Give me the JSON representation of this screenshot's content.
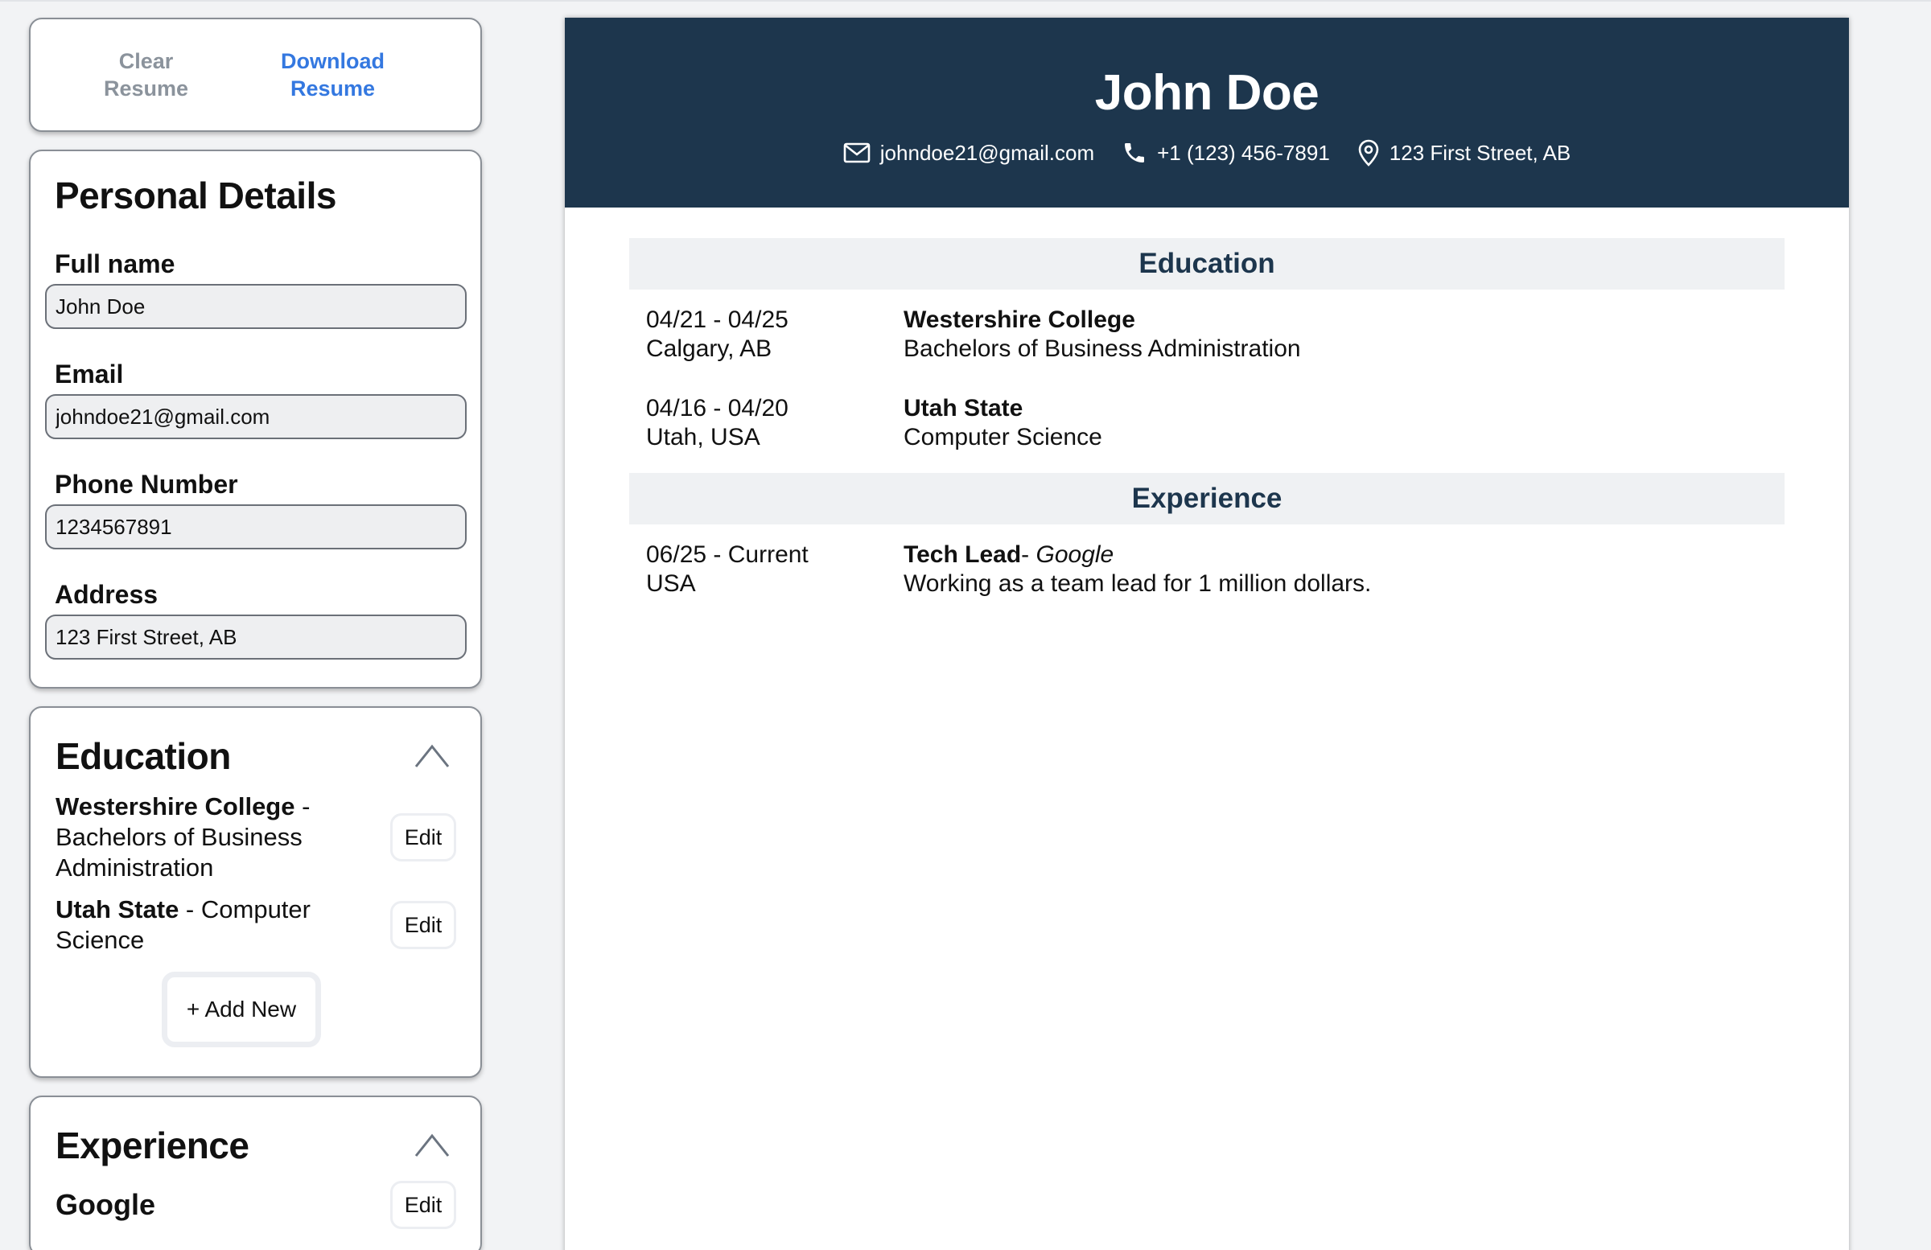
{
  "actions": {
    "clear_label": "Clear Resume",
    "download_label": "Download Resume"
  },
  "personal": {
    "title": "Personal Details",
    "fields": {
      "full_name": {
        "label": "Full name",
        "value": "John Doe"
      },
      "email": {
        "label": "Email",
        "value": "johndoe21@gmail.com"
      },
      "phone": {
        "label": "Phone Number",
        "value": "1234567891"
      },
      "address": {
        "label": "Address",
        "value": "123 First Street, AB"
      }
    }
  },
  "education_panel": {
    "title": "Education",
    "toggle_icon": "chevron-up-icon",
    "entries": [
      {
        "school": "Westershire College",
        "separator": " - ",
        "degree": "Bachelors of Business Administration",
        "edit_label": "Edit"
      },
      {
        "school": "Utah State",
        "separator": " - ",
        "degree": "Computer Science",
        "edit_label": "Edit"
      }
    ],
    "add_label": "+ Add New"
  },
  "experience_panel": {
    "title": "Experience",
    "toggle_icon": "chevron-up-icon",
    "entries": [
      {
        "company": "Google",
        "edit_label": "Edit"
      }
    ]
  },
  "resume": {
    "name": "John Doe",
    "contact": {
      "email": "johndoe21@gmail.com",
      "phone": "+1 (123) 456-7891",
      "address": "123 First Street, AB"
    },
    "education": {
      "heading": "Education",
      "entries": [
        {
          "dates": "04/21 - 04/25",
          "location": "Calgary, AB",
          "school": "Westershire College",
          "degree": "Bachelors of Business Administration"
        },
        {
          "dates": "04/16 - 04/20",
          "location": "Utah, USA",
          "school": "Utah State",
          "degree": "Computer Science"
        }
      ]
    },
    "experience": {
      "heading": "Experience",
      "entries": [
        {
          "dates": "06/25 - Current",
          "location": "USA",
          "position": "Tech Lead",
          "separator": "- ",
          "company": "Google",
          "description": "Working as a team lead for 1 million dollars."
        }
      ]
    }
  },
  "colors": {
    "header_bg": "#1d364d",
    "link_blue": "#3478e0",
    "muted_gray": "#8b939c",
    "section_bar_bg": "#eff1f3"
  }
}
